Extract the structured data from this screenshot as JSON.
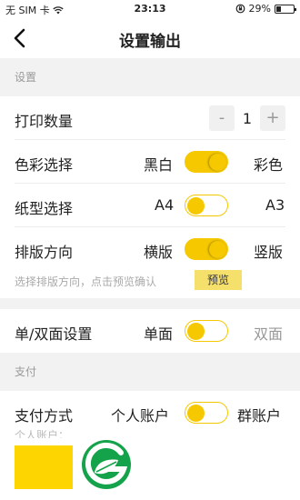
{
  "status_bar": {
    "carrier": "无 SIM 卡",
    "time": "23:13",
    "battery": "29%",
    "battery_level": 0.29
  },
  "nav": {
    "title": "设置输出"
  },
  "sections": {
    "settings": "设置",
    "payment": "支付"
  },
  "rows": {
    "copies": {
      "label": "打印数量",
      "minus": "-",
      "value": "1",
      "plus": "+"
    },
    "color": {
      "label": "色彩选择",
      "option_left": "黑白",
      "option_right": "彩色"
    },
    "paper": {
      "label": "纸型选择",
      "option_left": "A4",
      "option_right": "A3"
    },
    "layout": {
      "label": "排版方向",
      "option_left": "横版",
      "option_right": "竖版"
    },
    "duplex": {
      "label": "单/双面设置",
      "option_left": "单面",
      "option_right": "双面"
    },
    "payment": {
      "label": "支付方式",
      "option_left": "个人账户",
      "option_right": "群账户"
    }
  },
  "hint": {
    "text": "选择排版方向，点击预览确认",
    "preview_label": "预览"
  },
  "partial_text": "个人账户：",
  "colors": {
    "accent": "#f5c800",
    "section_bg": "#f2f2f2"
  }
}
